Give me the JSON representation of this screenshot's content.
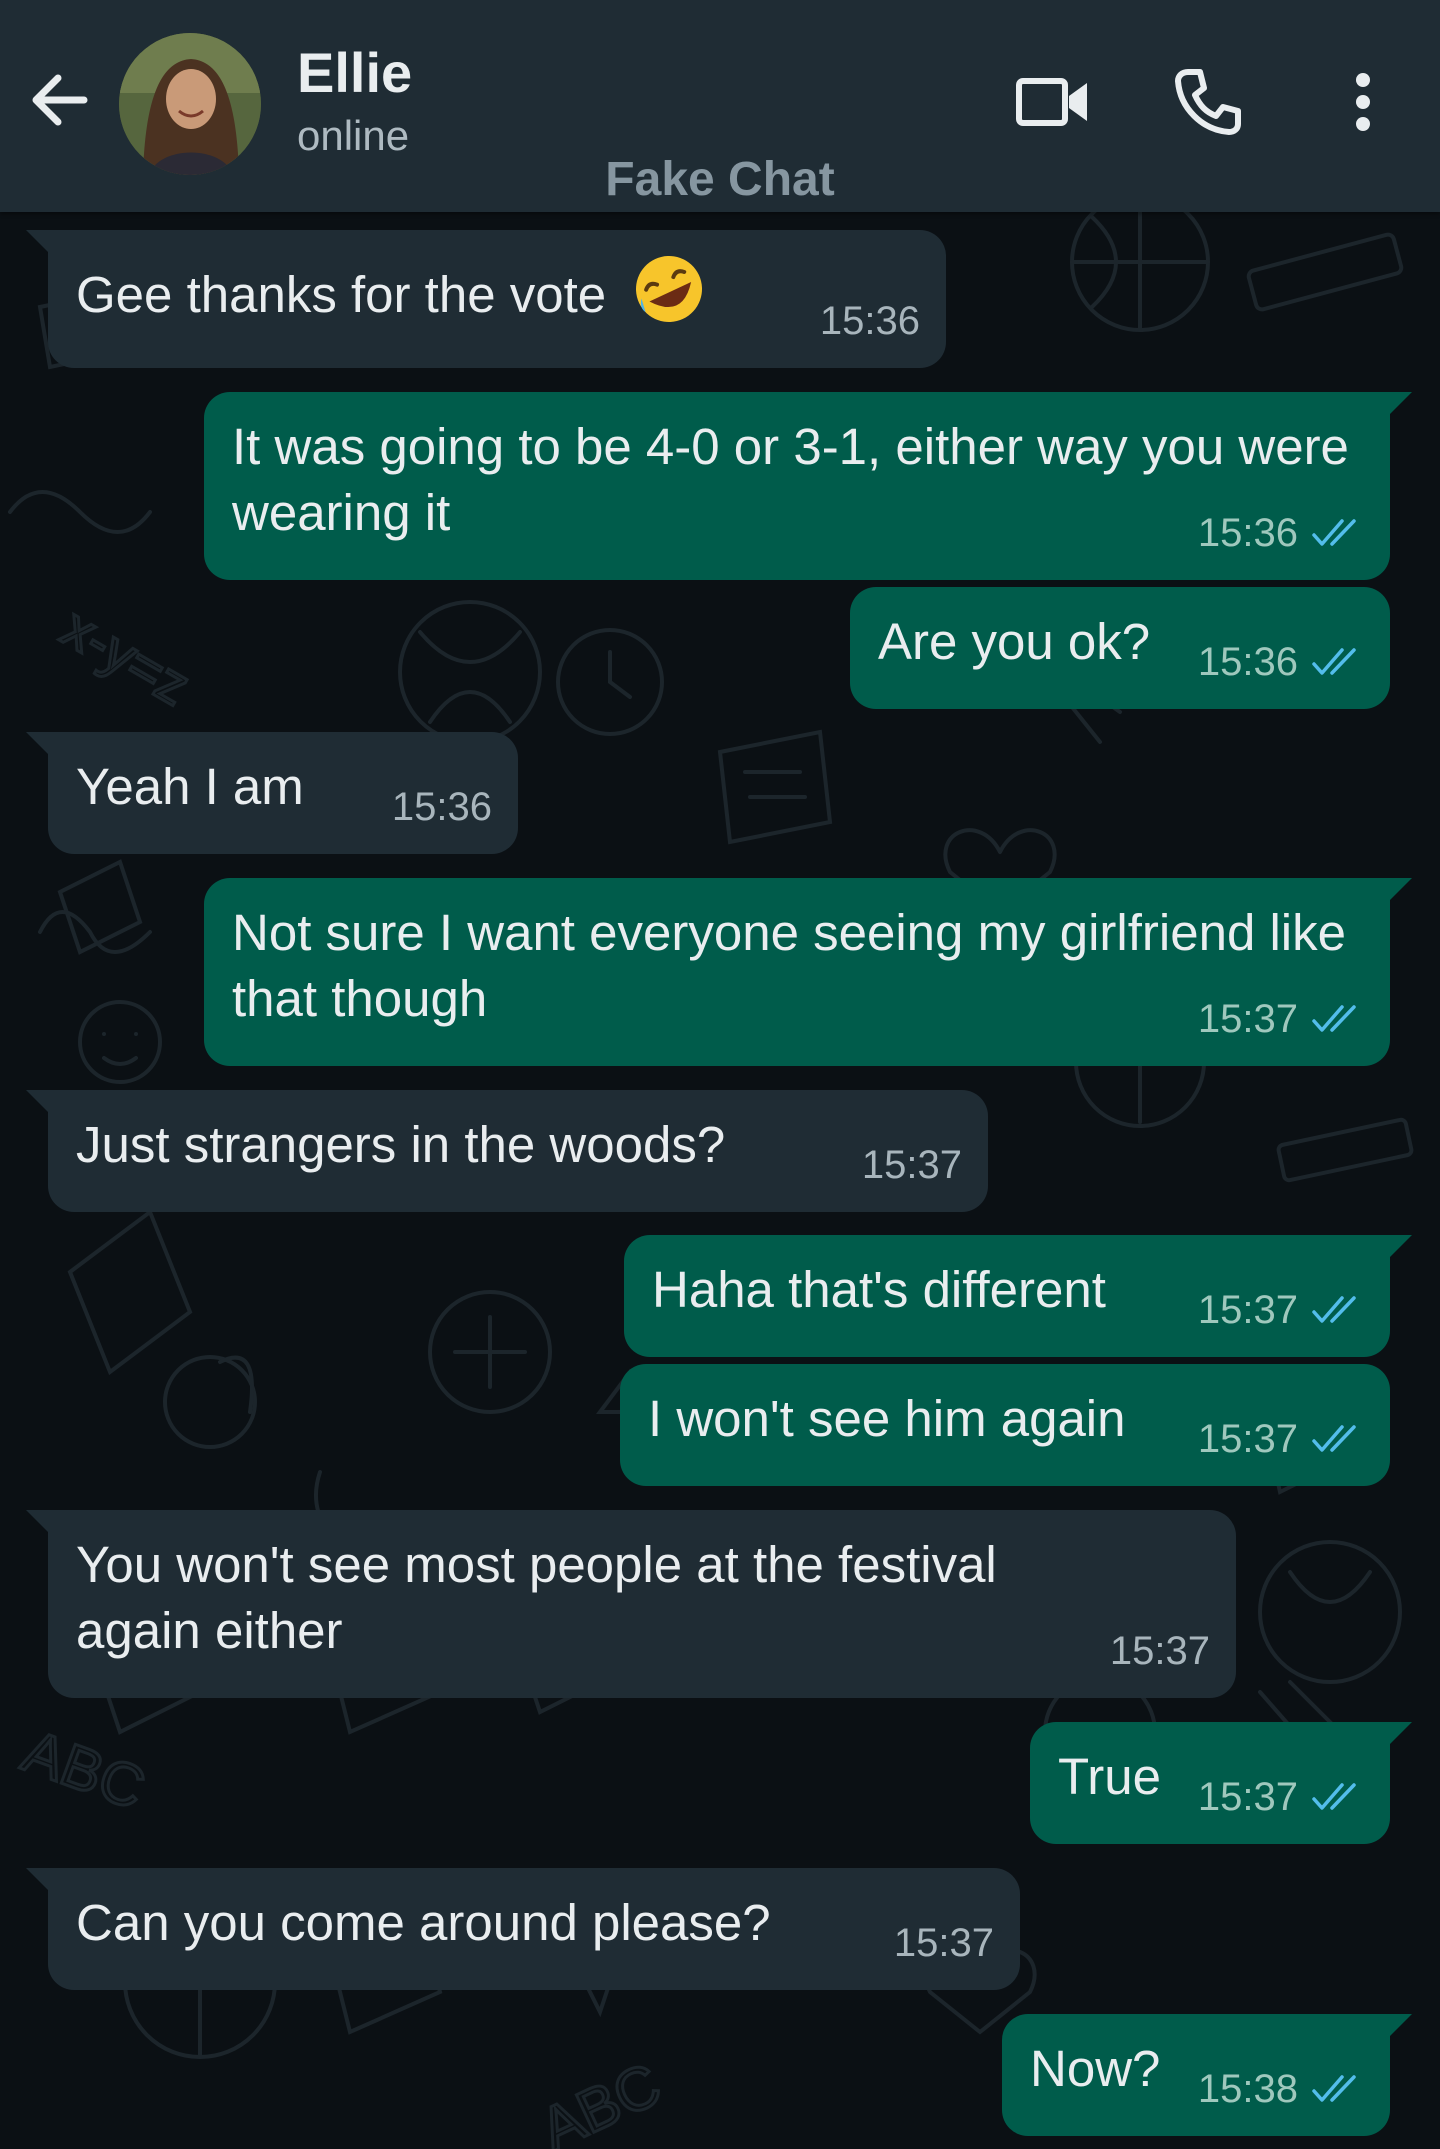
{
  "header": {
    "contact_name": "Ellie",
    "status": "online",
    "watermark": "Fake Chat",
    "icons": [
      "back-arrow-icon",
      "video-call-icon",
      "voice-call-icon",
      "more-vert-icon"
    ]
  },
  "colors": {
    "header_bg": "#1f2c34",
    "chat_bg": "#0b1014",
    "incoming_bubble": "#1f2c34",
    "outgoing_bubble": "#005c4b",
    "read_ticks": "#53bdeb"
  },
  "messages": [
    {
      "dir": "in",
      "text": "Gee thanks for the vote",
      "emoji": "rolling-on-floor-laughing-emoji",
      "time": "15:36"
    },
    {
      "dir": "out",
      "text": "It was going to be 4-0 or 3-1, either way you were wearing it",
      "time": "15:36",
      "status": "read"
    },
    {
      "dir": "out",
      "text": "Are you ok?",
      "time": "15:36",
      "status": "read"
    },
    {
      "dir": "in",
      "text": "Yeah I am",
      "time": "15:36"
    },
    {
      "dir": "out",
      "text": "Not sure I want everyone seeing my girlfriend like that though",
      "time": "15:37",
      "status": "read"
    },
    {
      "dir": "in",
      "text": "Just strangers in the woods?",
      "time": "15:37"
    },
    {
      "dir": "out",
      "text": "Haha that's different",
      "time": "15:37",
      "status": "read"
    },
    {
      "dir": "out",
      "text": "I won't see him again",
      "time": "15:37",
      "status": "read"
    },
    {
      "dir": "in",
      "text": "You won't see most people at the festival again either",
      "time": "15:37"
    },
    {
      "dir": "out",
      "text": "True",
      "time": "15:37",
      "status": "read"
    },
    {
      "dir": "in",
      "text": "Can you come around please?",
      "time": "15:37"
    },
    {
      "dir": "out",
      "text": "Now?",
      "time": "15:38",
      "status": "read"
    }
  ]
}
